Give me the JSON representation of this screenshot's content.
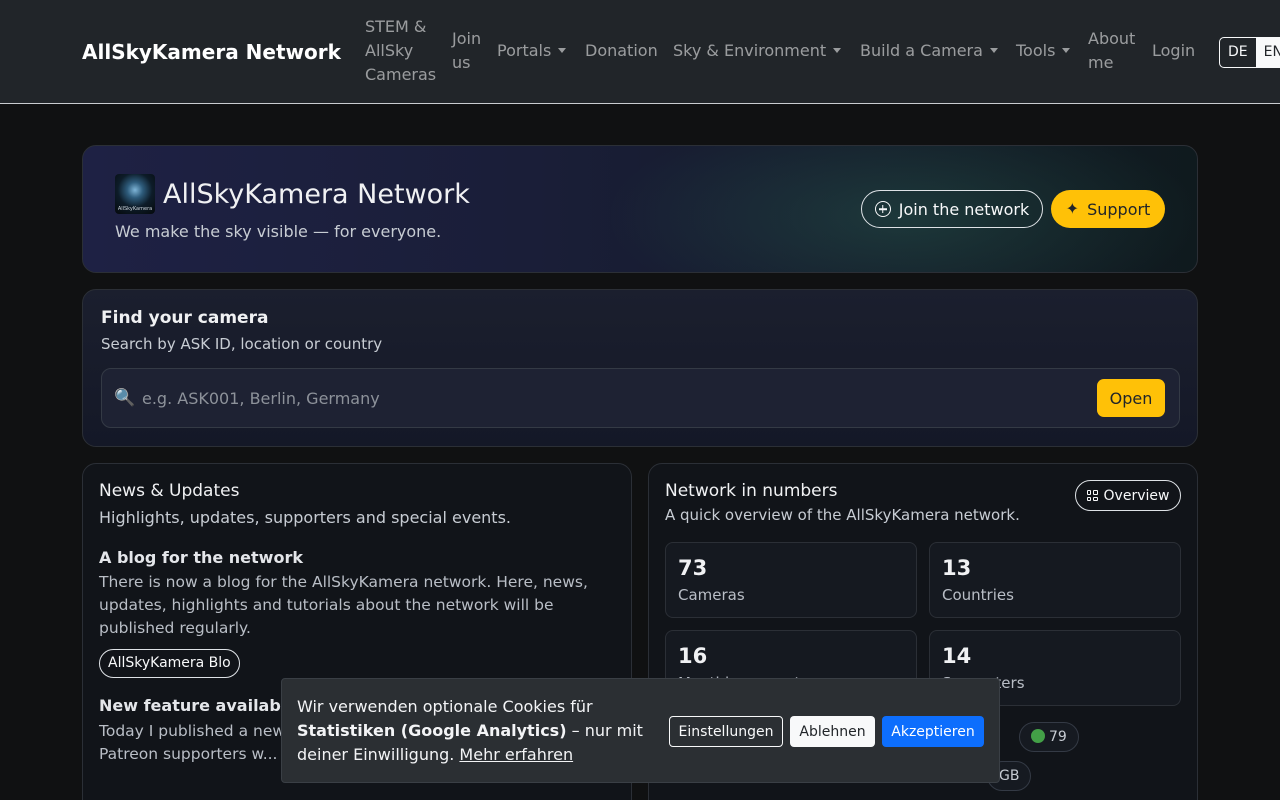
{
  "navbar": {
    "brand": "AllSkyKamera Network",
    "items": [
      {
        "label": "STEM & AllSky Cameras"
      },
      {
        "label": "Join us"
      },
      {
        "label": "Portals"
      },
      {
        "label": "Donation"
      },
      {
        "label": "Sky & Environment"
      },
      {
        "label": "Build a Camera"
      },
      {
        "label": "Tools"
      },
      {
        "label": "About me"
      },
      {
        "label": "Login"
      }
    ],
    "languages": [
      "DE",
      "EN"
    ],
    "active_language": "EN"
  },
  "hero": {
    "logo_text": "AllSkyKamera",
    "title": "AllSkyKamera Network",
    "subtitle": "We make the sky visible — for everyone.",
    "join_label": "Join the network",
    "support_label": "Support"
  },
  "search": {
    "title": "Find your camera",
    "subtitle": "Search by ASK ID, location or country",
    "placeholder": "e.g. ASK001, Berlin, Germany",
    "open_label": "Open"
  },
  "news": {
    "title": "News & Updates",
    "subtitle": "Highlights, updates, supporters and special events.",
    "items": [
      {
        "heading": "A blog for the network",
        "text": "There is now a blog for the AllSkyKamera network. Here, news, updates, highlights and tutorials about the network will be published regularly.",
        "tag": "AllSkyKamera Blo"
      },
      {
        "heading": "New feature availab",
        "text": "Today I published a new ... directly from the AllSky... for Patreon supporters w..."
      }
    ]
  },
  "stats": {
    "title": "Network in numbers",
    "subtitle": "A quick overview of the AllSkyKamera network.",
    "overview_label": "Overview",
    "boxes": [
      {
        "value": "73",
        "label": "Cameras"
      },
      {
        "value": "13",
        "label": "Countries"
      },
      {
        "value": "16",
        "label": "Monthly supporters"
      },
      {
        "value": "14",
        "label": "Supporters"
      }
    ],
    "pills": [
      {
        "text": "79",
        "status_color": "#43a047"
      },
      {
        "text": "GB"
      }
    ]
  },
  "cookie": {
    "text_before": "Wir verwenden optionale Cookies für ",
    "text_bold": "Statistiken (Google Analytics)",
    "text_after": " – nur mit deiner Einwilligung. ",
    "link": "Mehr erfahren",
    "settings_label": "Einstellungen",
    "decline_label": "Ablehnen",
    "accept_label": "Akzeptieren"
  },
  "colors": {
    "accent": "#ffc107",
    "primary": "#0d6efd",
    "background": "#101112",
    "navbar": "#212529"
  },
  "icons": {
    "join": "plus-circle-icon",
    "support": "sparkle-icon",
    "search": "magnifier-icon",
    "overview": "grid-icon"
  }
}
